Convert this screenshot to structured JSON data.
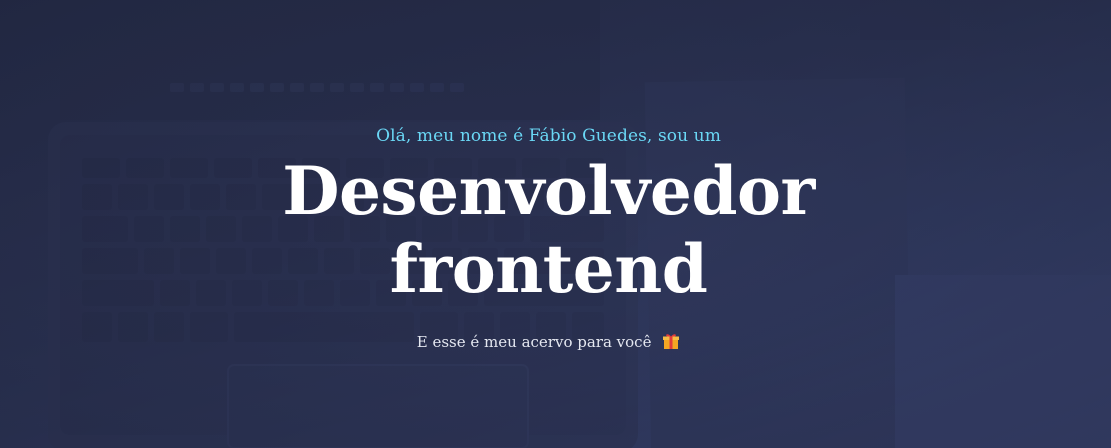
{
  "hero": {
    "greeting": "Olá, meu nome é Fábio Guedes, sou um",
    "headline_line1": "Desenvolvedor",
    "headline_line2": "frontend",
    "subline": "E esse é meu acervo para você",
    "subline_icon": "gift-icon"
  },
  "colors": {
    "background": "#2c3455",
    "accent": "#6ad7f5",
    "headline": "#ffffff",
    "subline": "#e4e7f0"
  }
}
